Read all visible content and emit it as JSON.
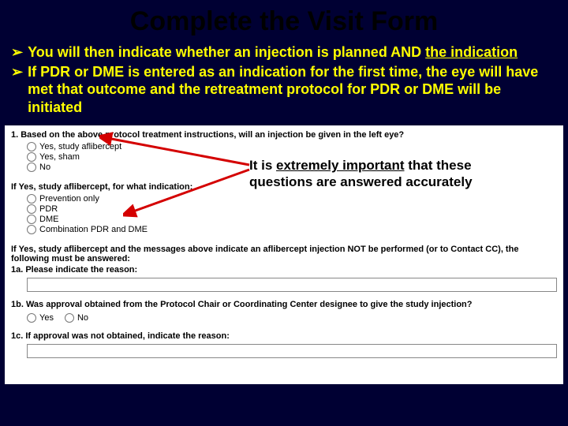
{
  "title": "Complete the Visit Form",
  "bullets": [
    {
      "pre": "You will then indicate whether an injection is planned AND ",
      "u": "the indication",
      "post": ""
    },
    {
      "pre": "If PDR or DME is entered as an indication for the first time, the eye will have met that outcome and the retreatment protocol  for PDR or DME will be initiated",
      "u": "",
      "post": ""
    }
  ],
  "callout": {
    "pre": "It is ",
    "u": "extremely important",
    "post": " that these questions are answered accurately"
  },
  "form": {
    "q1": "1. Based on the above protocol treatment instructions, will an injection be given in the left eye?",
    "q1_opts": [
      "Yes, study aflibercept",
      "Yes, sham",
      "No"
    ],
    "sub_if_yes": "If Yes, study aflibercept, for what indication:",
    "ind_opts": [
      "Prevention only",
      "PDR",
      "DME",
      "Combination PDR and DME"
    ],
    "q_ifnot": "If Yes, study aflibercept and the messages above indicate an aflibercept injection NOT be performed (or to Contact CC), the following must be answered:",
    "q1a": "1a. Please indicate the reason:",
    "q1b": "1b. Was approval obtained from the Protocol Chair or Coordinating Center designee to give the study injection?",
    "q1b_opts": [
      "Yes",
      "No"
    ],
    "q1c": "1c. If approval was not obtained, indicate the reason:"
  }
}
